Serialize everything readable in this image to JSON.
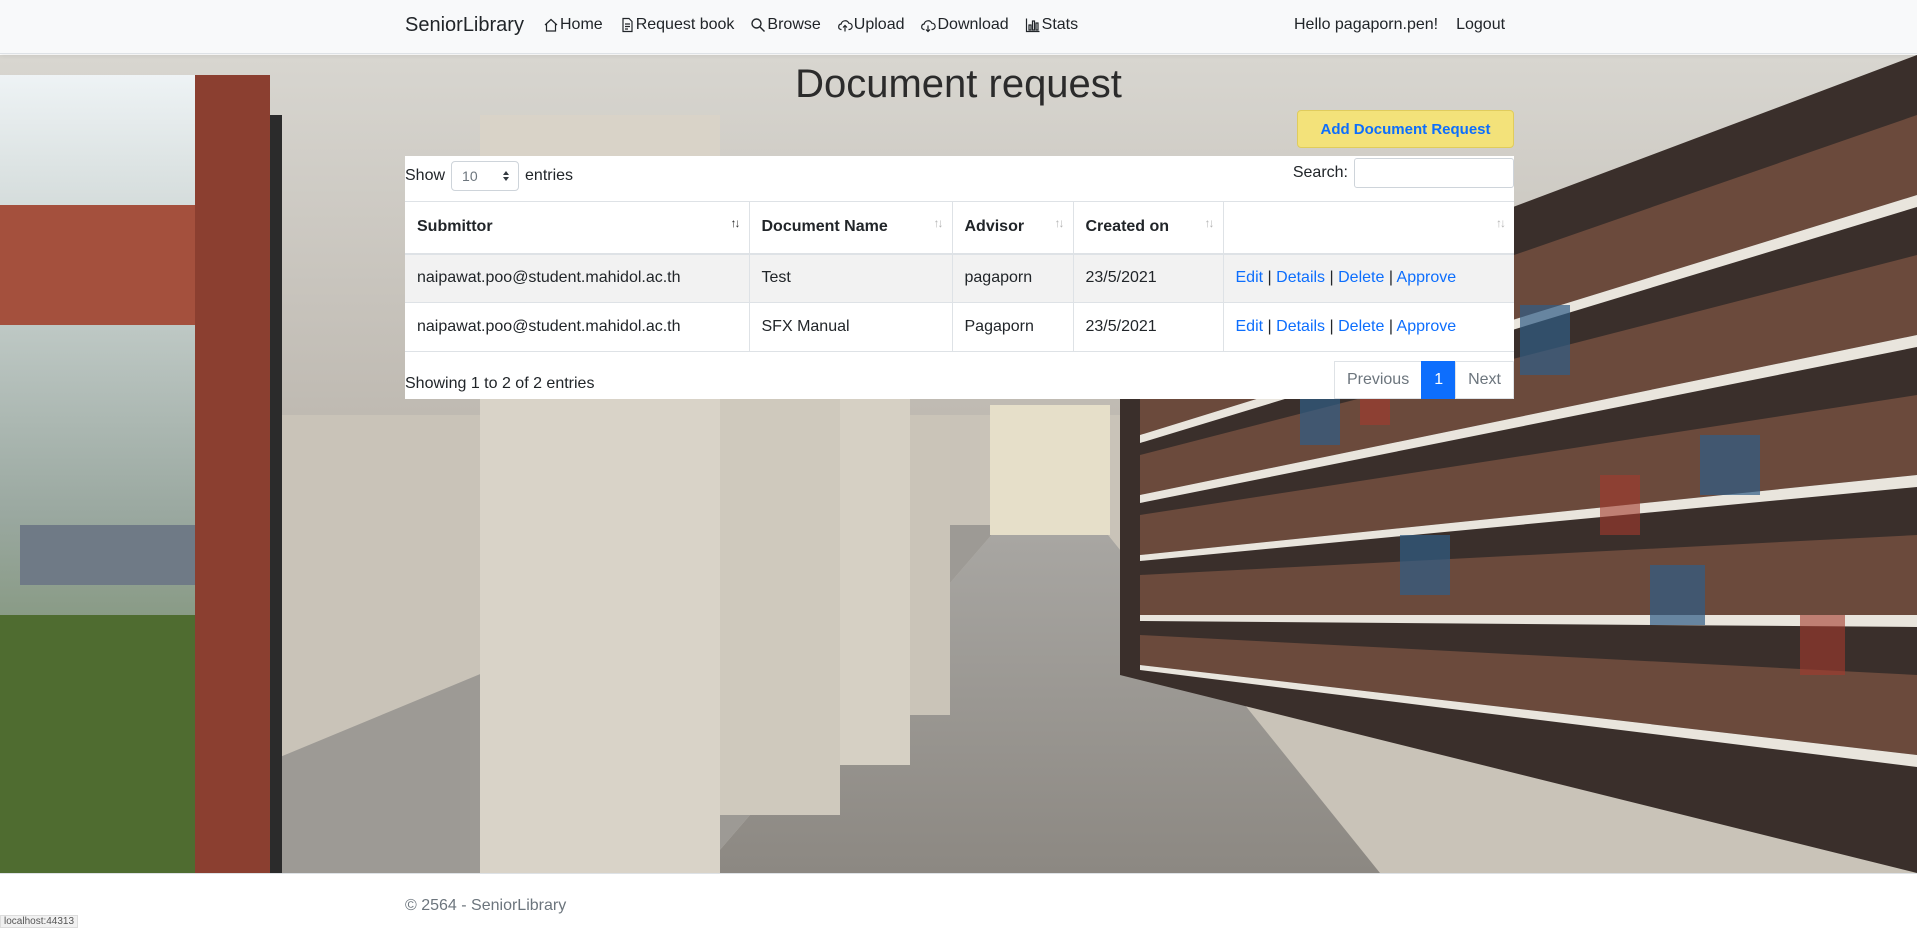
{
  "navbar": {
    "brand": "SeniorLibrary",
    "links": [
      {
        "label": "Home",
        "icon": "house-icon"
      },
      {
        "label": "Request book",
        "icon": "document-icon"
      },
      {
        "label": "Browse",
        "icon": "search-icon"
      },
      {
        "label": "Upload",
        "icon": "cloud-upload-icon"
      },
      {
        "label": "Download",
        "icon": "cloud-download-icon"
      },
      {
        "label": "Stats",
        "icon": "bar-chart-icon"
      }
    ],
    "greeting": "Hello pagaporn.pen!",
    "logout": "Logout"
  },
  "page": {
    "title": "Document request",
    "add_button": "Add Document Request"
  },
  "table_controls": {
    "show_label": "Show",
    "page_length": "10",
    "entries_label": "entries",
    "search_label": "Search:",
    "search_value": ""
  },
  "table": {
    "columns": [
      "Submittor",
      "Document Name",
      "Advisor",
      "Created on",
      ""
    ],
    "rows": [
      {
        "submittor": "naipawat.poo@student.mahidol.ac.th",
        "document": "Test",
        "advisor": "pagaporn",
        "created": "23/5/2021"
      },
      {
        "submittor": "naipawat.poo@student.mahidol.ac.th",
        "document": "SFX Manual",
        "advisor": "Pagaporn",
        "created": "23/5/2021"
      }
    ],
    "actions": {
      "edit": "Edit",
      "details": "Details",
      "delete": "Delete",
      "approve": "Approve",
      "separator": "|"
    }
  },
  "table_footer": {
    "info": "Showing 1 to 2 of 2 entries",
    "previous": "Previous",
    "current_page": "1",
    "next": "Next"
  },
  "footer": {
    "text": "© 2564 - SeniorLibrary"
  },
  "status_bar": {
    "url": "localhost:44313"
  }
}
